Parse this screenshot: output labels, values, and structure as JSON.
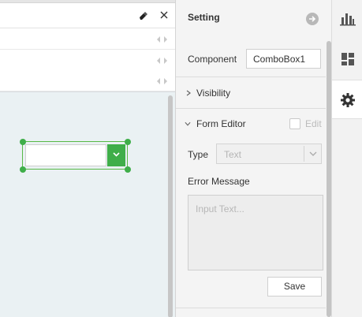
{
  "panel": {
    "title": "Setting",
    "component_label": "Component",
    "component_value": "ComboBox1",
    "visibility_label": "Visibility",
    "form_editor_label": "Form Editor",
    "edit_label": "Edit",
    "type_label": "Type",
    "type_value": "Text",
    "error_message_label": "Error Message",
    "error_placeholder": "Input Text...",
    "save_label": "Save"
  },
  "rail": {
    "items": [
      {
        "icon": "bar-chart-icon",
        "active": false
      },
      {
        "icon": "widgets-grid-icon",
        "active": false
      },
      {
        "icon": "gear-icon",
        "active": true
      }
    ]
  },
  "colors": {
    "accent_green": "#3fae49",
    "panel_bg": "#f4f4f4",
    "canvas_bg": "#eaf1f3"
  }
}
